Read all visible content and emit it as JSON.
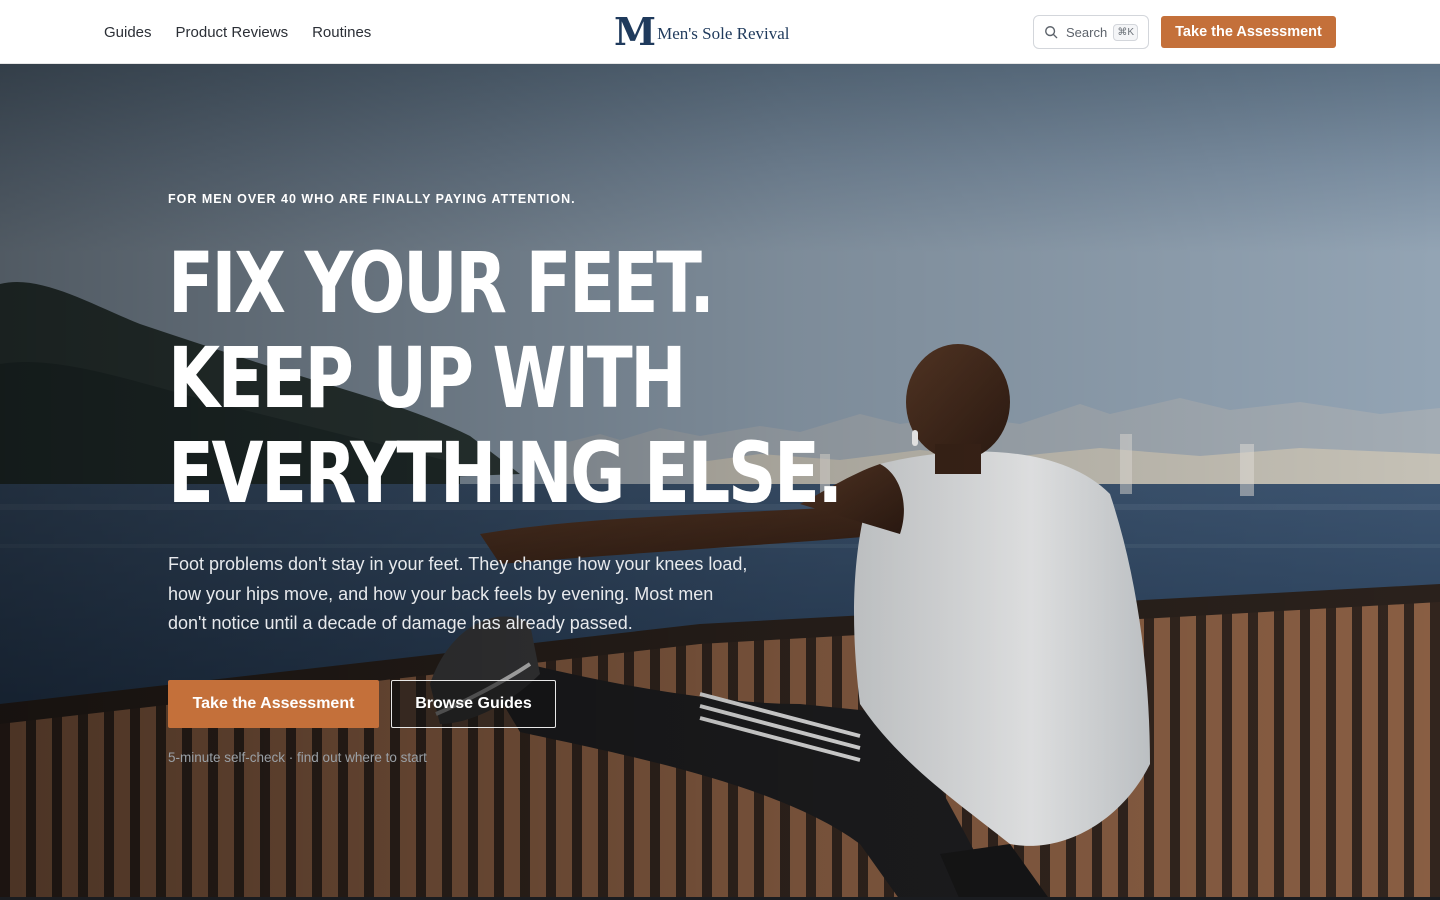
{
  "nav": {
    "links": [
      "Guides",
      "Product Reviews",
      "Routines"
    ],
    "brand_mark": "M",
    "brand_name": "Men's Sole Revival",
    "search_label": "Search",
    "search_shortcut": "⌘K",
    "cta_label": "Take the Assessment"
  },
  "hero": {
    "eyebrow": "FOR MEN OVER 40 WHO ARE FINALLY PAYING ATTENTION.",
    "headline_lines": [
      "FIX YOUR FEET.",
      "KEEP UP WITH",
      "EVERYTHING ELSE."
    ],
    "subheading": "Foot problems don't stay in your feet. They change how your knees load, how your hips move, and how your back feels by evening. Most men don't notice until a decade of damage has already passed.",
    "primary_button": "Take the Assessment",
    "secondary_button": "Browse Guides",
    "note": "5-minute self-check · find out where to start"
  },
  "colors": {
    "accent": "#c4703a",
    "brand_navy": "#1f3a5c"
  }
}
